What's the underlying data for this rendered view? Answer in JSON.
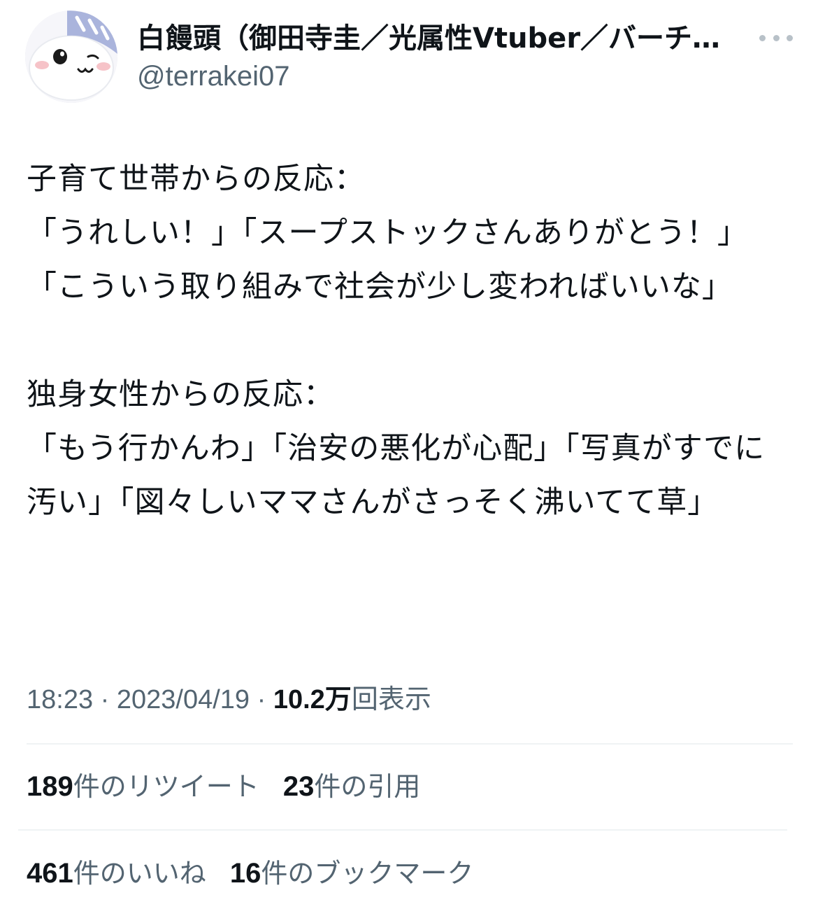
{
  "user": {
    "display_name": "白饅頭（御田寺圭／光属性Vtuber／バーチ…",
    "handle": "@terrakei07"
  },
  "icons": {
    "avatar": "blob-mascot-avatar",
    "more": "more-horizontal-icon"
  },
  "tweet": {
    "lines": [
      "子育て世帯からの反応：",
      "「うれしい！」「スープストックさんありがとう！」「こういう取り組みで社会が少し変わればいいな」",
      "",
      "独身女性からの反応：",
      "「もう行かんわ」「治安の悪化が心配」「写真がすでに汚い」「図々しいママさんがさっそく沸いてて草」"
    ]
  },
  "meta": {
    "time": "18:23",
    "date": "2023/04/19",
    "views_count": "10.2万",
    "views_label": "回表示"
  },
  "stats": {
    "retweets_count": "189",
    "retweets_label": "件のリツイート",
    "quotes_count": "23",
    "quotes_label": "件の引用",
    "likes_count": "461",
    "likes_label": "件のいいね",
    "bookmarks_count": "16",
    "bookmarks_label": "件のブックマーク"
  },
  "colors": {
    "text": "#0f1419",
    "secondary": "#536471",
    "divider": "#eff3f4",
    "avatar_hat": "#aab4dc"
  }
}
